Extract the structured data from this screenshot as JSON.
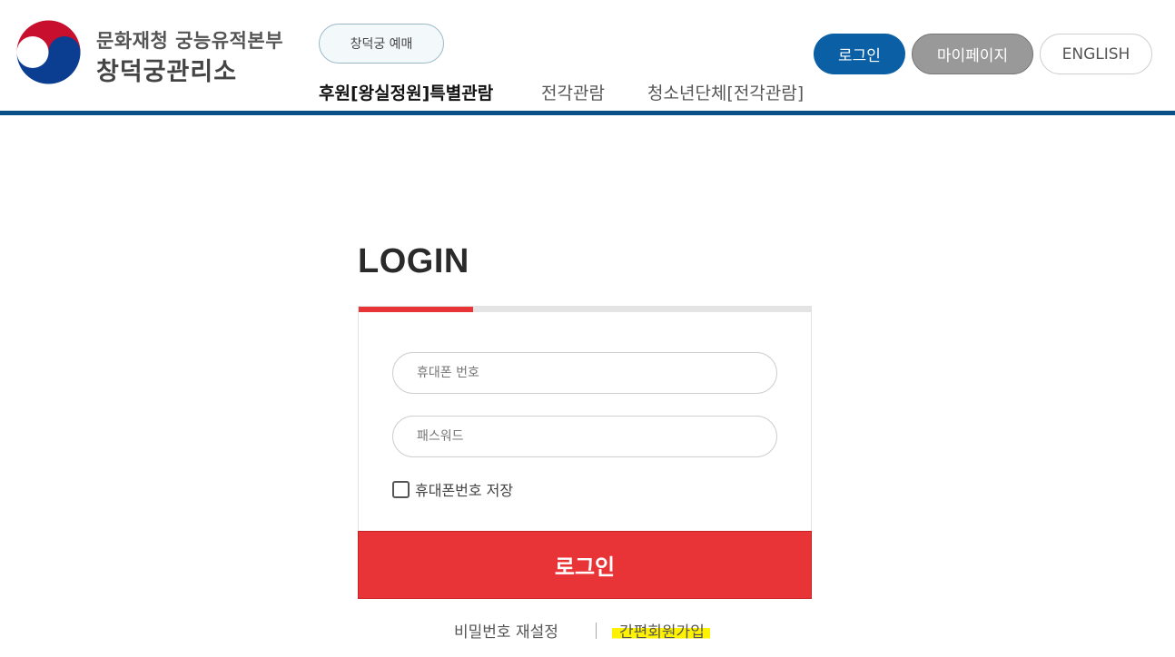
{
  "header": {
    "logo": {
      "org": "문화재청 궁능유적본부",
      "name": "창덕궁관리소",
      "emblem_icon": "taegeuk-emblem-icon"
    },
    "reserve_button": "창덕궁 예매",
    "nav": [
      {
        "label": "후원[왕실정원]특별관람",
        "active": true
      },
      {
        "label": "전각관람",
        "active": false
      },
      {
        "label": "청소년단체[전각관람]",
        "active": false
      }
    ],
    "buttons": {
      "login": "로그인",
      "mypage": "마이페이지",
      "english": "ENGLISH"
    }
  },
  "login": {
    "title": "LOGIN",
    "phone_placeholder": "휴대폰 번호",
    "password_placeholder": "패스워드",
    "remember_label": "휴대폰번호 저장",
    "submit": "로그인",
    "links": {
      "reset_password": "비밀번호 재설정",
      "simple_signup": "간편회원가입"
    }
  },
  "colors": {
    "accent_blue": "#0b5fa5",
    "header_line": "#0a4f86",
    "accent_red": "#e83437",
    "highlight": "#fff200"
  }
}
